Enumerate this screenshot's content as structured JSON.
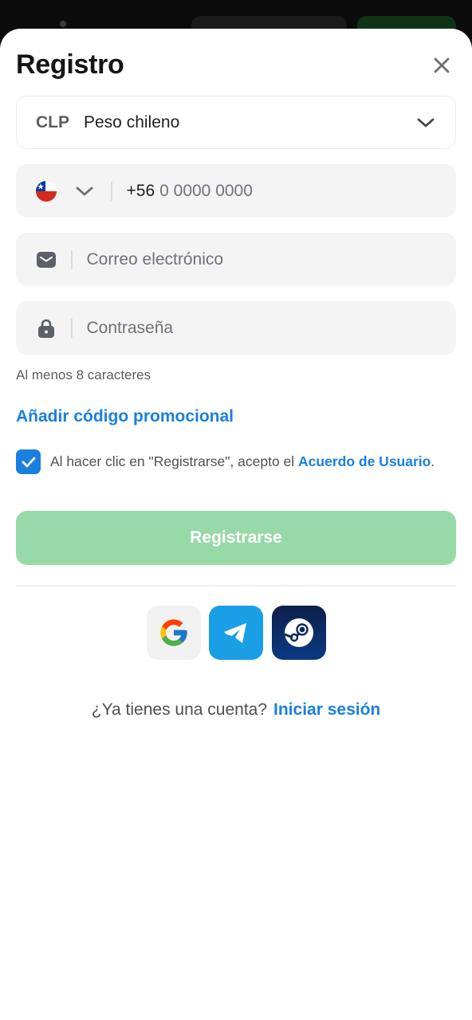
{
  "title": "Registro",
  "currency": {
    "code": "CLP",
    "name": "Peso chileno"
  },
  "phone": {
    "prefix": "+56",
    "placeholder": "0 0000 0000"
  },
  "email": {
    "placeholder": "Correo electrónico"
  },
  "password": {
    "placeholder": "Contraseña",
    "hint": "Al menos 8 caracteres"
  },
  "promo_link": "Añadir código promocional",
  "terms": {
    "checked": true,
    "text": "Al hacer clic en \"Registrarse\", acepto el ",
    "link": "Acuerdo de Usuario",
    "suffix": "."
  },
  "register_button": "Registrarse",
  "social": [
    "google-icon",
    "telegram-icon",
    "steam-icon"
  ],
  "footer": {
    "question": "¿Ya tienes una cuenta?",
    "login_link": "Iniciar sesión"
  },
  "colors": {
    "accent": "#1a7fde",
    "register_disabled": "#98d9a8",
    "field_bg": "#f4f4f5"
  }
}
